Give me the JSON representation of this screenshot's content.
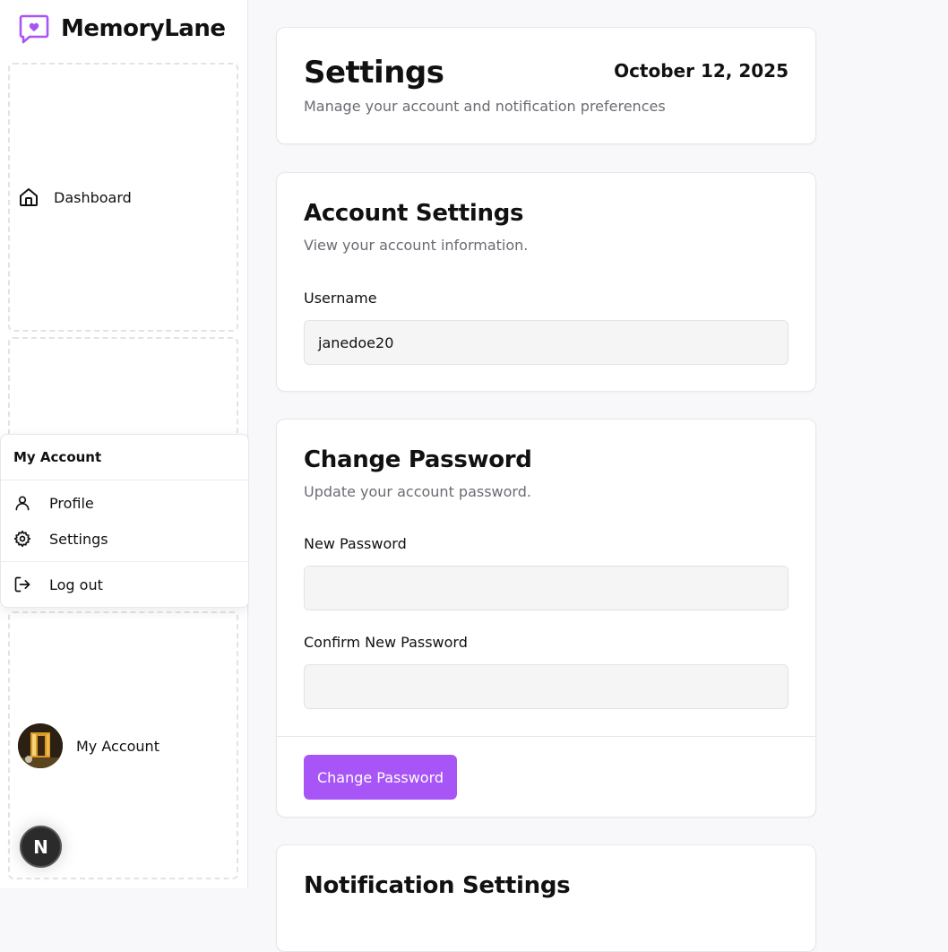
{
  "app": {
    "name": "MemoryLane"
  },
  "sidebar": {
    "nav": [
      {
        "label": "Dashboard",
        "icon": "home-icon"
      }
    ],
    "account": {
      "label": "My Account",
      "avatar": "avatar-image"
    }
  },
  "account_menu": {
    "title": "My Account",
    "items": [
      {
        "label": "Profile",
        "icon": "user-icon"
      },
      {
        "label": "Settings",
        "icon": "gear-icon"
      },
      {
        "label": "Log out",
        "icon": "logout-icon"
      }
    ]
  },
  "badge": {
    "letter": "N"
  },
  "header": {
    "title": "Settings",
    "subtitle": "Manage your account and notification preferences",
    "date": "October 12, 2025"
  },
  "account_settings": {
    "title": "Account Settings",
    "subtitle": "View your account information.",
    "username_label": "Username",
    "username_value": "janedoe20"
  },
  "change_password": {
    "title": "Change Password",
    "subtitle": "Update your account password.",
    "new_password_label": "New Password",
    "new_password_value": "",
    "confirm_password_label": "Confirm New Password",
    "confirm_password_value": "",
    "button_label": "Change Password"
  },
  "notification_settings": {
    "title": "Notification Settings"
  },
  "colors": {
    "accent": "#a855f7",
    "muted_text": "#6b6b73",
    "border": "#e5e7eb"
  }
}
